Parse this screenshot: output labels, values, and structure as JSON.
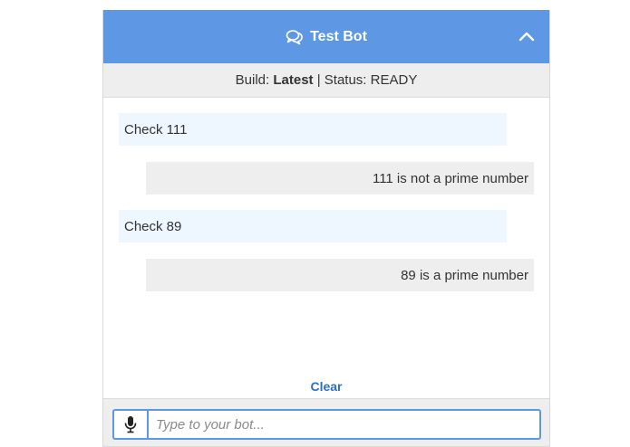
{
  "header": {
    "title": "Test Bot",
    "icon": "chat-bubbles-icon",
    "collapse_icon": "chevron-up-icon",
    "bg_color": "#5e97e3"
  },
  "status": {
    "build_label": "Build: ",
    "build_value": "Latest",
    "separator": " | ",
    "status_text": "Status: READY"
  },
  "messages": [
    {
      "role": "user",
      "text": "Check 111"
    },
    {
      "role": "bot",
      "text": "111 is not a prime number"
    },
    {
      "role": "user",
      "text": "Check 89"
    },
    {
      "role": "bot",
      "text": "89 is a prime number"
    }
  ],
  "clear_label": "Clear",
  "input": {
    "placeholder": "Type to your bot...",
    "value": "",
    "mic_icon": "microphone-icon"
  }
}
